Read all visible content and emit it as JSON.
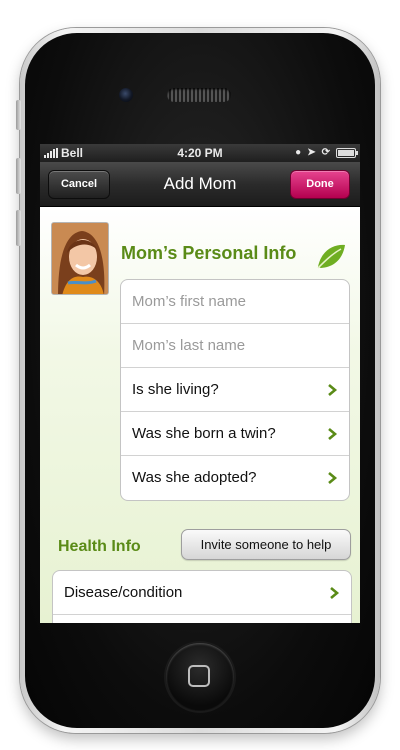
{
  "status_bar": {
    "carrier": "Bell",
    "time": "4:20 PM"
  },
  "nav": {
    "cancel_label": "Cancel",
    "title": "Add Mom",
    "done_label": "Done"
  },
  "personal": {
    "title": "Mom’s Personal Info",
    "first_name_placeholder": "Mom’s first name",
    "last_name_placeholder": "Mom’s last name",
    "rows": [
      {
        "label": "Is she living?"
      },
      {
        "label": "Was she born a twin?"
      },
      {
        "label": "Was she adopted?"
      }
    ]
  },
  "health": {
    "title": "Health Info",
    "invite_label": "Invite someone to help",
    "rows": [
      {
        "label": "Disease/condition"
      }
    ]
  },
  "colors": {
    "accent_green": "#5a8b17",
    "done_pink": "#c8176c",
    "chevron_green": "#5a8b17"
  },
  "icons": {
    "leaf": "leaf-icon",
    "chevron": "chevron-right-icon",
    "home": "home-button-icon"
  }
}
